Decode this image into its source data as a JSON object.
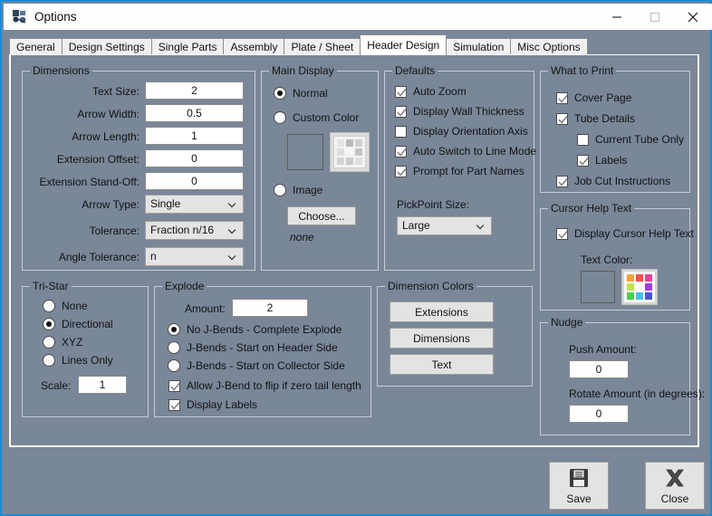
{
  "window": {
    "title": "Options",
    "icon": "app-options-icon",
    "border_color": "#1a8ad4",
    "background": "#7a8799",
    "minimize_label": "Minimize",
    "maximize_label": "Maximize",
    "close_label": "Close"
  },
  "tabs": [
    {
      "label": "General",
      "active": false
    },
    {
      "label": "Design Settings",
      "active": false
    },
    {
      "label": "Single Parts",
      "active": false
    },
    {
      "label": "Assembly",
      "active": false
    },
    {
      "label": "Plate / Sheet",
      "active": false
    },
    {
      "label": "Header Design",
      "active": true
    },
    {
      "label": "Simulation",
      "active": false
    },
    {
      "label": "Misc Options",
      "active": false
    }
  ],
  "dimensions": {
    "title": "Dimensions",
    "fields": [
      {
        "label": "Text Size:",
        "value": "2"
      },
      {
        "label": "Arrow Width:",
        "value": "0.5"
      },
      {
        "label": "Arrow Length:",
        "value": "1"
      },
      {
        "label": "Extension Offset:",
        "value": "0"
      },
      {
        "label": "Extension Stand-Off:",
        "value": "0"
      }
    ],
    "selects": [
      {
        "label": "Arrow Type:",
        "value": "Single"
      },
      {
        "label": "Tolerance:",
        "value": "Fraction n/16"
      },
      {
        "label": "Angle Tolerance:",
        "value": "n"
      }
    ]
  },
  "main_display": {
    "title": "Main Display",
    "options": [
      {
        "label": "Normal",
        "selected": true
      },
      {
        "label": "Custom Color",
        "selected": false
      },
      {
        "label": "Image",
        "selected": false
      }
    ],
    "color_swatch_name": "custom-color-swatch",
    "palette_name": "custom-color-palette-button",
    "choose_label": "Choose...",
    "image_status": "none"
  },
  "defaults": {
    "title": "Defaults",
    "checkboxes": [
      {
        "label": "Auto Zoom",
        "checked": true
      },
      {
        "label": "Display Wall Thickness",
        "checked": true
      },
      {
        "label": "Display Orientation Axis",
        "checked": false
      },
      {
        "label": "Auto Switch to Line Mode",
        "checked": true
      },
      {
        "label": "Prompt for Part Names",
        "checked": true
      }
    ],
    "pickpoint_label": "PickPoint Size:",
    "pickpoint_value": "Large"
  },
  "what_to_print": {
    "title": "What to Print",
    "checkboxes": [
      {
        "label": "Cover Page",
        "checked": true,
        "indent": false
      },
      {
        "label": "Tube Details",
        "checked": true,
        "indent": false
      },
      {
        "label": "Current Tube Only",
        "checked": false,
        "indent": true
      },
      {
        "label": "Labels",
        "checked": true,
        "indent": true
      },
      {
        "label": "Job Cut Instructions",
        "checked": true,
        "indent": false
      }
    ]
  },
  "cursor_help": {
    "title": "Cursor Help Text",
    "checkbox": {
      "label": "Display Cursor Help Text",
      "checked": true
    },
    "text_color_label": "Text Color:",
    "swatch_name": "cursor-help-text-color-swatch",
    "palette_name": "cursor-help-text-color-palette-button",
    "palette_colors": [
      "#f5a13c",
      "#f2504c",
      "#ef3f9e",
      "#c3e050",
      "#fdfdfd",
      "#a33de0",
      "#4ad04a",
      "#46bdf0",
      "#4a52e0"
    ]
  },
  "nudge": {
    "title": "Nudge",
    "push_label": "Push Amount:",
    "push_value": "0",
    "rotate_label": "Rotate Amount (in degrees):",
    "rotate_value": "0"
  },
  "tristar": {
    "title": "Tri-Star",
    "options": [
      {
        "label": "None",
        "selected": false
      },
      {
        "label": "Directional",
        "selected": true
      },
      {
        "label": "XYZ",
        "selected": false
      },
      {
        "label": "Lines Only",
        "selected": false
      }
    ],
    "scale_label": "Scale:",
    "scale_value": "1"
  },
  "explode": {
    "title": "Explode",
    "amount_label": "Amount:",
    "amount_value": "2",
    "radios": [
      {
        "label": "No J-Bends  -  Complete Explode",
        "selected": true
      },
      {
        "label": "J-Bends  -  Start on Header Side",
        "selected": false
      },
      {
        "label": "J-Bends  -  Start on Collector Side",
        "selected": false
      }
    ],
    "checkboxes": [
      {
        "label": "Allow J-Bend to flip if zero tail length",
        "checked": true
      },
      {
        "label": "Display Labels",
        "checked": true
      }
    ]
  },
  "dimension_colors": {
    "title": "Dimension Colors",
    "buttons": [
      "Extensions",
      "Dimensions",
      "Text"
    ]
  },
  "footer": {
    "save_label": "Save",
    "save_icon": "floppy-disk-icon",
    "close_label": "Close",
    "close_icon": "x-mark-icon"
  }
}
